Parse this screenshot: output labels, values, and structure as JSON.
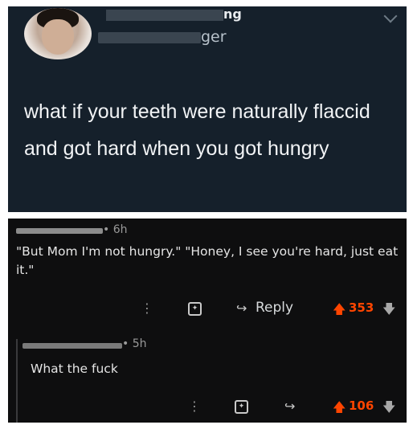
{
  "tweet": {
    "name_tail": "ng",
    "handle_prefix": "@",
    "handle_tail": "ger",
    "text": "what if your teeth were naturally flaccid and got hard when you got hungry"
  },
  "comment1": {
    "time": "• 6h",
    "body": "\"But Mom I'm not hungry.\" \"Honey, I see you're hard, just eat it.\"",
    "reply_label": "Reply",
    "score": "353"
  },
  "comment2": {
    "time": "• 5h",
    "body": "What the fuck",
    "score": "106"
  },
  "icons": {
    "more": "⋮",
    "reply": "↪",
    "upvote": "🡅",
    "downvote": "🡇"
  },
  "colors": {
    "tweet_bg": "#15202b",
    "reddit_bg": "#0e0e0f",
    "upvote": "#ff4500"
  }
}
